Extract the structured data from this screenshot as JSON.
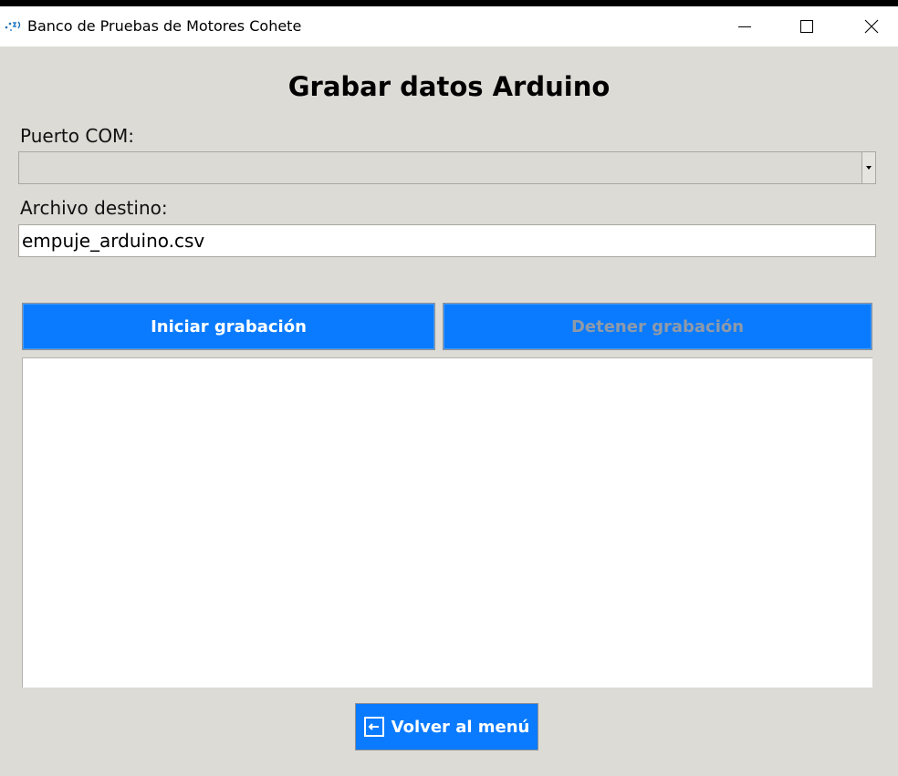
{
  "window": {
    "title": "Banco de Pruebas de Motores Cohete",
    "controls": [
      "minimize-icon",
      "maximize-icon",
      "close-icon"
    ]
  },
  "page": {
    "heading": "Grabar datos Arduino"
  },
  "form": {
    "port_label": "Puerto COM:",
    "port_value": "",
    "file_label": "Archivo destino:",
    "file_value": "empuje_arduino.csv"
  },
  "actions": {
    "start_label": "Iniciar grabación",
    "stop_label": "Detener grabación",
    "back_label": "Volver al menú"
  },
  "log": {
    "content": ""
  },
  "colors": {
    "button_bg": "#0a7bff",
    "window_bg": "#dddbd6",
    "disabled_text": "#8f9aa8"
  }
}
